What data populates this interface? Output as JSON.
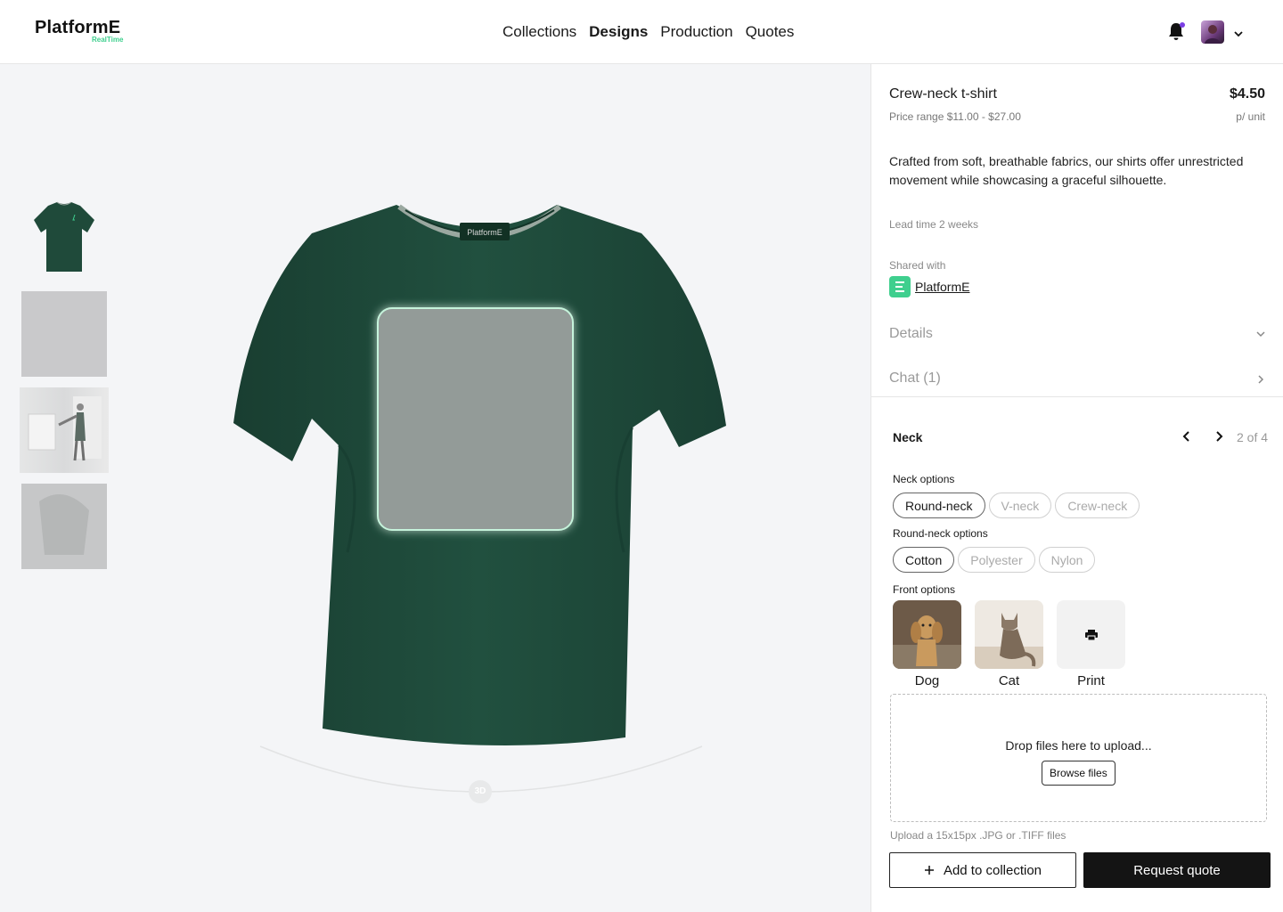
{
  "header": {
    "logo": "PlatformE",
    "logo_sub": "RealTime",
    "nav": [
      "Collections",
      "Designs",
      "Production",
      "Quotes"
    ],
    "active_nav": "Designs"
  },
  "viewer": {
    "badge": "3D",
    "shirt_label": "PlatformE"
  },
  "product": {
    "title": "Crew-neck t-shirt",
    "price": "$4.50",
    "price_range": "Price range $11.00 - $27.00",
    "unit": "p/ unit",
    "description": "Crafted from soft, breathable fabrics, our shirts offer unrestricted movement while showcasing a graceful silhouette.",
    "lead_time": "Lead time 2 weeks",
    "shared_label": "Shared with",
    "shared_name": "PlatformE"
  },
  "accordion": {
    "details": "Details",
    "chat": "Chat (1)"
  },
  "config": {
    "title": "Neck",
    "page": "2 of 4",
    "neck_label": "Neck options",
    "neck_options": [
      "Round-neck",
      "V-neck",
      "Crew-neck"
    ],
    "neck_selected": "Round-neck",
    "material_label": "Round-neck options",
    "material_options": [
      "Cotton",
      "Polyester",
      "Nylon"
    ],
    "material_selected": "Cotton",
    "front_label": "Front options",
    "front_options": [
      "Dog",
      "Cat",
      "Print"
    ]
  },
  "upload": {
    "drop_text": "Drop files here to upload...",
    "browse": "Browse files",
    "hint": "Upload a 15x15px .JPG or .TIFF files"
  },
  "actions": {
    "add": "Add to collection",
    "quote": "Request quote"
  },
  "colors": {
    "shirt": "#1f4a3a",
    "accent": "#3fcf8e",
    "primary_button": "#141414"
  }
}
